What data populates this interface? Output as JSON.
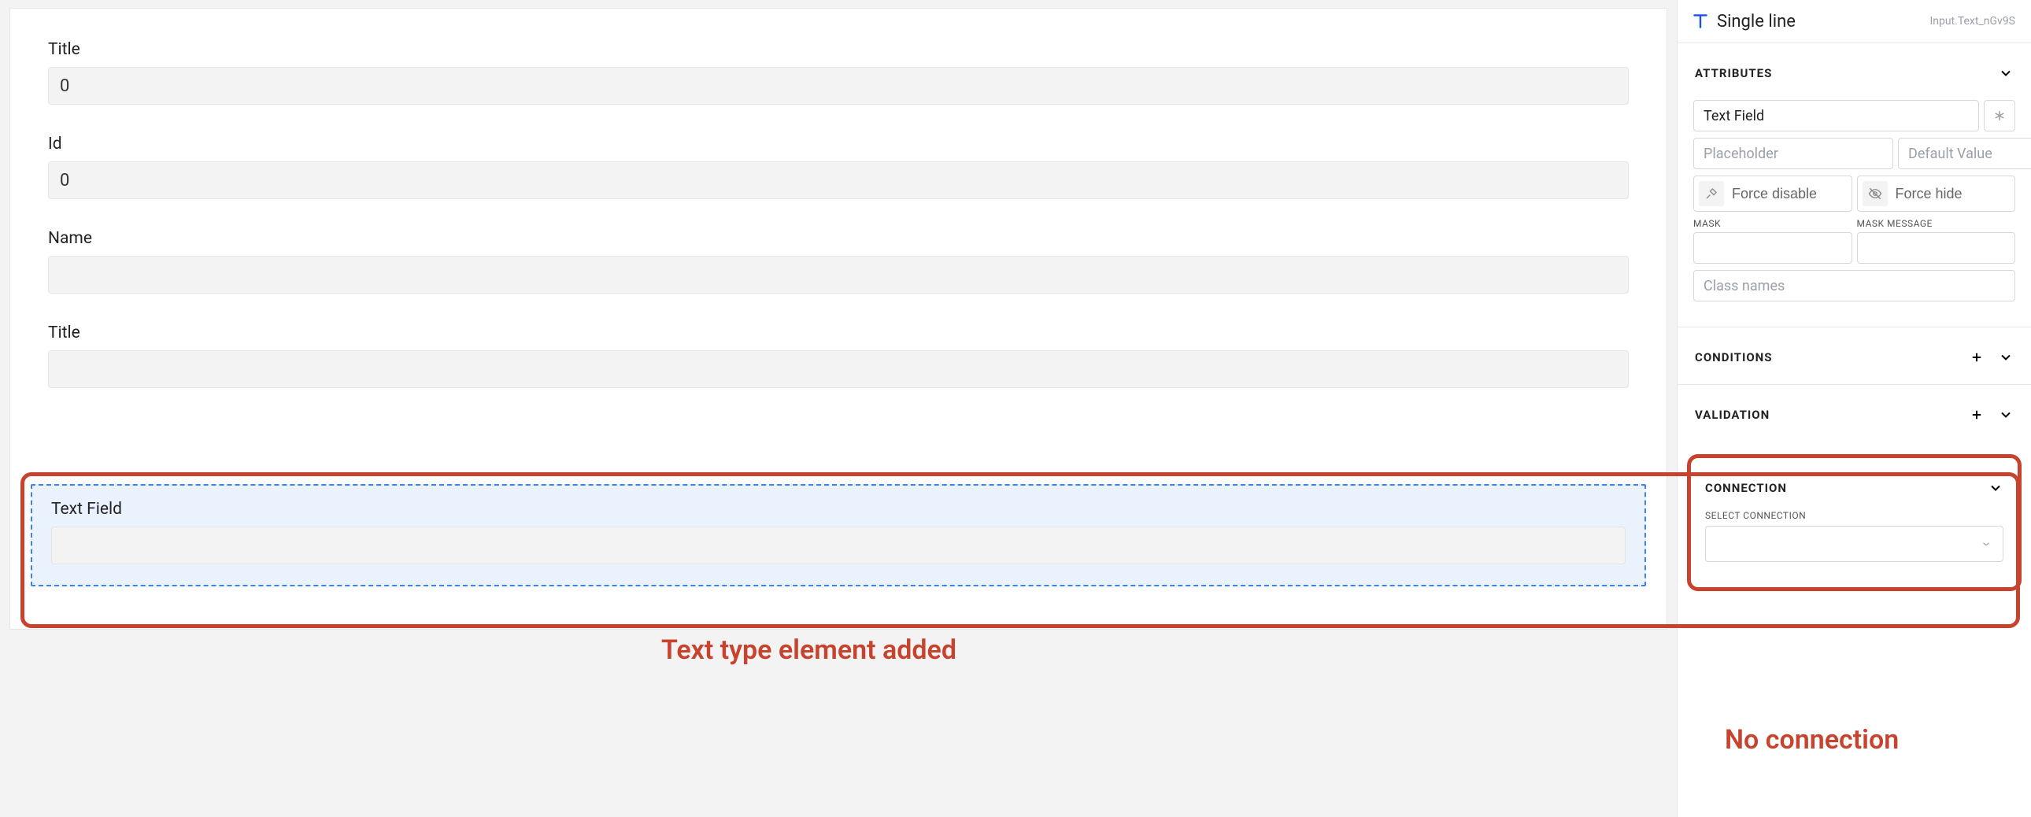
{
  "form": {
    "fields": [
      {
        "label": "Title",
        "value": "0"
      },
      {
        "label": "Id",
        "value": "0"
      },
      {
        "label": "Name",
        "value": ""
      },
      {
        "label": "Title",
        "value": ""
      }
    ],
    "selected": {
      "label": "Text Field",
      "value": ""
    },
    "annotation": "Text type element added"
  },
  "sidebar": {
    "icon_name": "text-icon",
    "title": "Single line",
    "component_id": "Input.Text_nGv9S",
    "sections": {
      "attributes": {
        "title": "ATTRIBUTES",
        "name_value": "Text Field",
        "placeholder_ph": "Placeholder",
        "default_ph": "Default Value",
        "force_disable": "Force disable",
        "force_hide": "Force hide",
        "mask_label": "MASK",
        "mask_msg_label": "MASK MESSAGE",
        "class_ph": "Class names"
      },
      "conditions": {
        "title": "CONDITIONS"
      },
      "validation": {
        "title": "VALIDATION"
      },
      "connection": {
        "title": "CONNECTION",
        "select_label": "SELECT CONNECTION",
        "select_value": ""
      }
    },
    "annotation": "No connection"
  }
}
